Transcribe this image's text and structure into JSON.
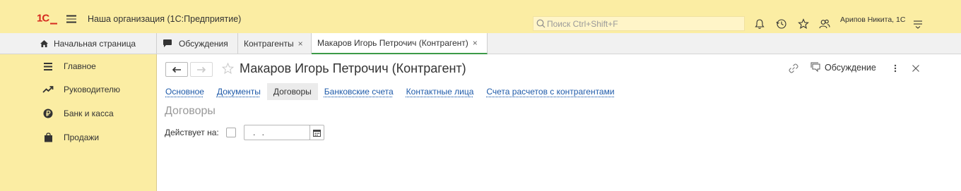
{
  "topbar": {
    "logo_text": "1С",
    "app_title": "Наша организация  (1С:Предприятие)",
    "search_placeholder": "Поиск Ctrl+Shift+F",
    "user_name": "Арипов Никита, 1С",
    "icons": [
      "menu-icon",
      "search-icon",
      "bell-icon",
      "history-icon",
      "star-icon",
      "users-icon",
      "settings-menu-icon"
    ]
  },
  "tabs": [
    {
      "label": "Начальная страница",
      "icon": "home-icon"
    },
    {
      "label": "Обсуждения",
      "icon": "chat-icon"
    },
    {
      "label": "Контрагенты",
      "close": "×"
    },
    {
      "label": "Макаров Игорь Петрочич (Контрагент)",
      "close": "×",
      "active": true
    }
  ],
  "sidebar": {
    "items": [
      {
        "label": "Главное",
        "icon": "list-icon"
      },
      {
        "label": "Руководителю",
        "icon": "trend-icon"
      },
      {
        "label": "Банк и касса",
        "icon": "ruble-icon"
      },
      {
        "label": "Продажи",
        "icon": "bag-icon"
      }
    ]
  },
  "form": {
    "title": "Макаров Игорь Петрочич (Контрагент)",
    "discuss_label": "Обсуждение",
    "sections": [
      {
        "label": "Основное"
      },
      {
        "label": "Документы"
      },
      {
        "label": "Договоры",
        "active": true
      },
      {
        "label": "Банковские счета"
      },
      {
        "label": "Контактные лица"
      },
      {
        "label": "Счета расчетов с контрагентами"
      }
    ],
    "group_title": "Договоры",
    "filter_label": "Действует на:",
    "date_value": ". ."
  },
  "colors": {
    "panel_yellow": "#fbeda3",
    "link_blue": "#1e5aa9",
    "active_tab_green": "#3c9a48",
    "logo_red": "#d62a1f"
  }
}
